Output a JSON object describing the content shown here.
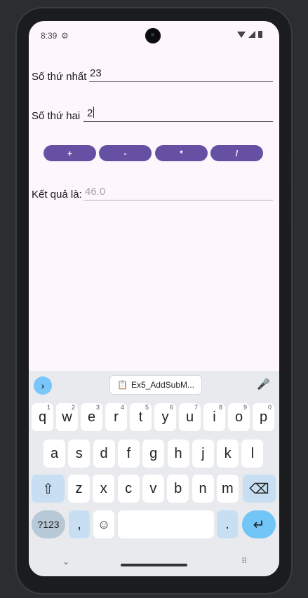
{
  "status_bar": {
    "time": "8:39",
    "settings_icon": "gear-icon"
  },
  "form": {
    "first_label": "Số thứ nhất",
    "first_value": "23",
    "second_label": "Số thứ hai",
    "second_value": "2",
    "result_label": "Kết quả là:",
    "result_value": "46.0"
  },
  "operations": [
    "+",
    "-",
    "*",
    "/"
  ],
  "colors": {
    "accent": "#6650a4",
    "screen_bg": "#fdf6fd",
    "keyboard_bg": "#e8eaed"
  },
  "keyboard": {
    "clipboard_chip": "Ex5_AddSubM...",
    "row1": [
      {
        "k": "q",
        "n": "1"
      },
      {
        "k": "w",
        "n": "2"
      },
      {
        "k": "e",
        "n": "3"
      },
      {
        "k": "r",
        "n": "4"
      },
      {
        "k": "t",
        "n": "5"
      },
      {
        "k": "y",
        "n": "6"
      },
      {
        "k": "u",
        "n": "7"
      },
      {
        "k": "i",
        "n": "8"
      },
      {
        "k": "o",
        "n": "9"
      },
      {
        "k": "p",
        "n": "0"
      }
    ],
    "row2": [
      "a",
      "s",
      "d",
      "f",
      "g",
      "h",
      "j",
      "k",
      "l"
    ],
    "row3": [
      "z",
      "x",
      "c",
      "v",
      "b",
      "n",
      "m"
    ],
    "symbols_key": "?123",
    "comma_key": ",",
    "period_key": "."
  }
}
